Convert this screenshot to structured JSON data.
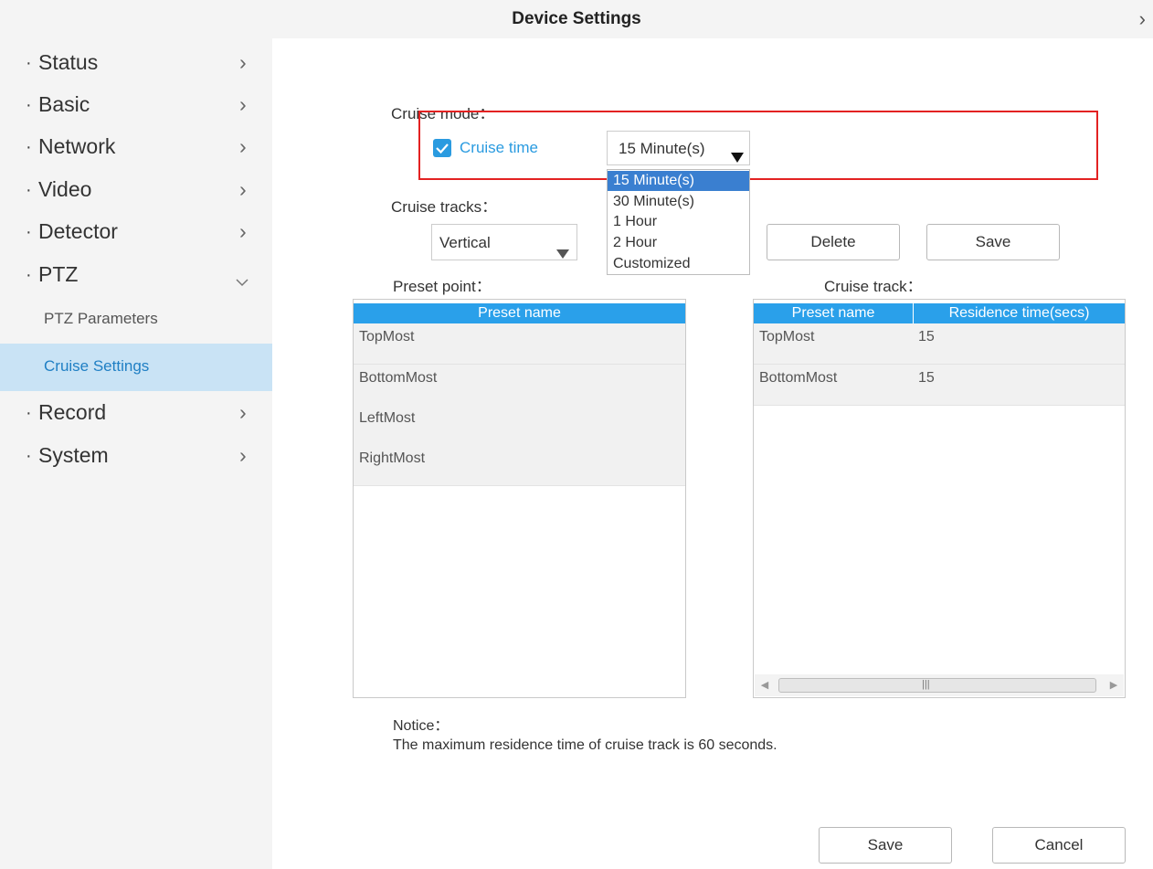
{
  "header": {
    "title": "Device Settings"
  },
  "sidebar": {
    "items": [
      {
        "label": "Status"
      },
      {
        "label": "Basic"
      },
      {
        "label": "Network"
      },
      {
        "label": "Video"
      },
      {
        "label": "Detector"
      },
      {
        "label": "PTZ"
      },
      {
        "label": "Record"
      },
      {
        "label": "System"
      }
    ],
    "sub_items": [
      {
        "label": "PTZ Parameters"
      },
      {
        "label": "Cruise Settings",
        "active": true
      }
    ]
  },
  "cruise_mode": {
    "label": "Cruise mode：",
    "checkbox_label": "Cruise time",
    "checked": true,
    "selected": "15 Minute(s)",
    "options": [
      "15 Minute(s)",
      "30 Minute(s)",
      "1 Hour",
      "2 Hour",
      "Customized"
    ]
  },
  "cruise_tracks": {
    "label": "Cruise tracks：",
    "selected": "Vertical",
    "delete_label": "Delete",
    "save_label": "Save"
  },
  "preset_point": {
    "label": "Preset point：",
    "header": "Preset name",
    "rows": [
      "TopMost",
      "BottomMost",
      "LeftMost",
      "RightMost"
    ]
  },
  "cruise_track": {
    "label": "Cruise track：",
    "headers": [
      "Preset name",
      "Residence time(secs)"
    ],
    "rows": [
      {
        "name": "TopMost",
        "time": "15"
      },
      {
        "name": "BottomMost",
        "time": "15"
      }
    ]
  },
  "notice": {
    "title": "Notice：",
    "text": "The maximum residence time of cruise track is 60 seconds."
  },
  "footer": {
    "save_label": "Save",
    "cancel_label": "Cancel"
  },
  "colors": {
    "accent": "#2aa0ea",
    "highlight": "#e32222",
    "active_bg": "#c9e3f5"
  }
}
